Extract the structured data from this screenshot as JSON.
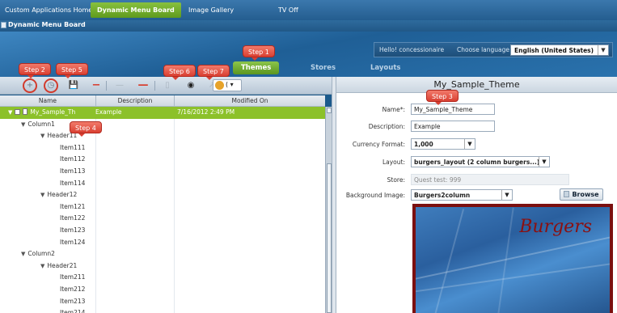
{
  "topnav": {
    "items": [
      "Custom Applications Home",
      "Dynamic Menu Board",
      "Image Gallery",
      "TV Off"
    ],
    "active_index": 1
  },
  "subbar": {
    "title": "Dynamic Menu Board"
  },
  "header": {
    "greeting": "Hello! concessionaire",
    "choose_language_label": "Choose language",
    "language_value": "English (United States)"
  },
  "tabs": [
    "Themes",
    "Stores",
    "Layouts"
  ],
  "steps": [
    "Step 1",
    "Step 2",
    "Step 3",
    "Step 4",
    "Step 5",
    "Step 6",
    "Step 7"
  ],
  "toolbar": {
    "combo_text": "( ▾"
  },
  "grid": {
    "columns": [
      "Name",
      "Description",
      "Modified On"
    ],
    "rows": [
      {
        "name": "My_Sample_Th",
        "desc": "Example",
        "mod": "7/16/2012 2:49 PM",
        "level": 0,
        "selected": true
      },
      {
        "name": "Column1",
        "desc": "",
        "mod": "",
        "level": 1
      },
      {
        "name": "Header11",
        "desc": "",
        "mod": "",
        "level": 2
      },
      {
        "name": "Item111",
        "desc": "",
        "mod": "",
        "level": 3
      },
      {
        "name": "Item112",
        "desc": "",
        "mod": "",
        "level": 3
      },
      {
        "name": "Item113",
        "desc": "",
        "mod": "",
        "level": 3
      },
      {
        "name": "Item114",
        "desc": "",
        "mod": "",
        "level": 3
      },
      {
        "name": "Header12",
        "desc": "",
        "mod": "",
        "level": 2
      },
      {
        "name": "Item121",
        "desc": "",
        "mod": "",
        "level": 3
      },
      {
        "name": "Item122",
        "desc": "",
        "mod": "",
        "level": 3
      },
      {
        "name": "Item123",
        "desc": "",
        "mod": "",
        "level": 3
      },
      {
        "name": "Item124",
        "desc": "",
        "mod": "",
        "level": 3
      },
      {
        "name": "Column2",
        "desc": "",
        "mod": "",
        "level": 1
      },
      {
        "name": "Header21",
        "desc": "",
        "mod": "",
        "level": 2
      },
      {
        "name": "Item211",
        "desc": "",
        "mod": "",
        "level": 3
      },
      {
        "name": "Item212",
        "desc": "",
        "mod": "",
        "level": 3
      },
      {
        "name": "Item213",
        "desc": "",
        "mod": "",
        "level": 3
      },
      {
        "name": "Item214",
        "desc": "",
        "mod": "",
        "level": 3
      }
    ]
  },
  "details": {
    "title": "My_Sample_Theme",
    "name_label": "Name*:",
    "name_value": "My_Sample_Theme",
    "description_label": "Description:",
    "description_value": "Example",
    "currency_label": "Currency Format:",
    "currency_value": "1,000",
    "layout_label": "Layout:",
    "layout_value": "burgers_layout (2 column burgers...)",
    "store_label": "Store:",
    "store_value": "Quest test: 999",
    "bg_label": "Background Image:",
    "bg_value": "Burgers2column",
    "browse_label": "Browse",
    "preview_text": "Burgers"
  }
}
